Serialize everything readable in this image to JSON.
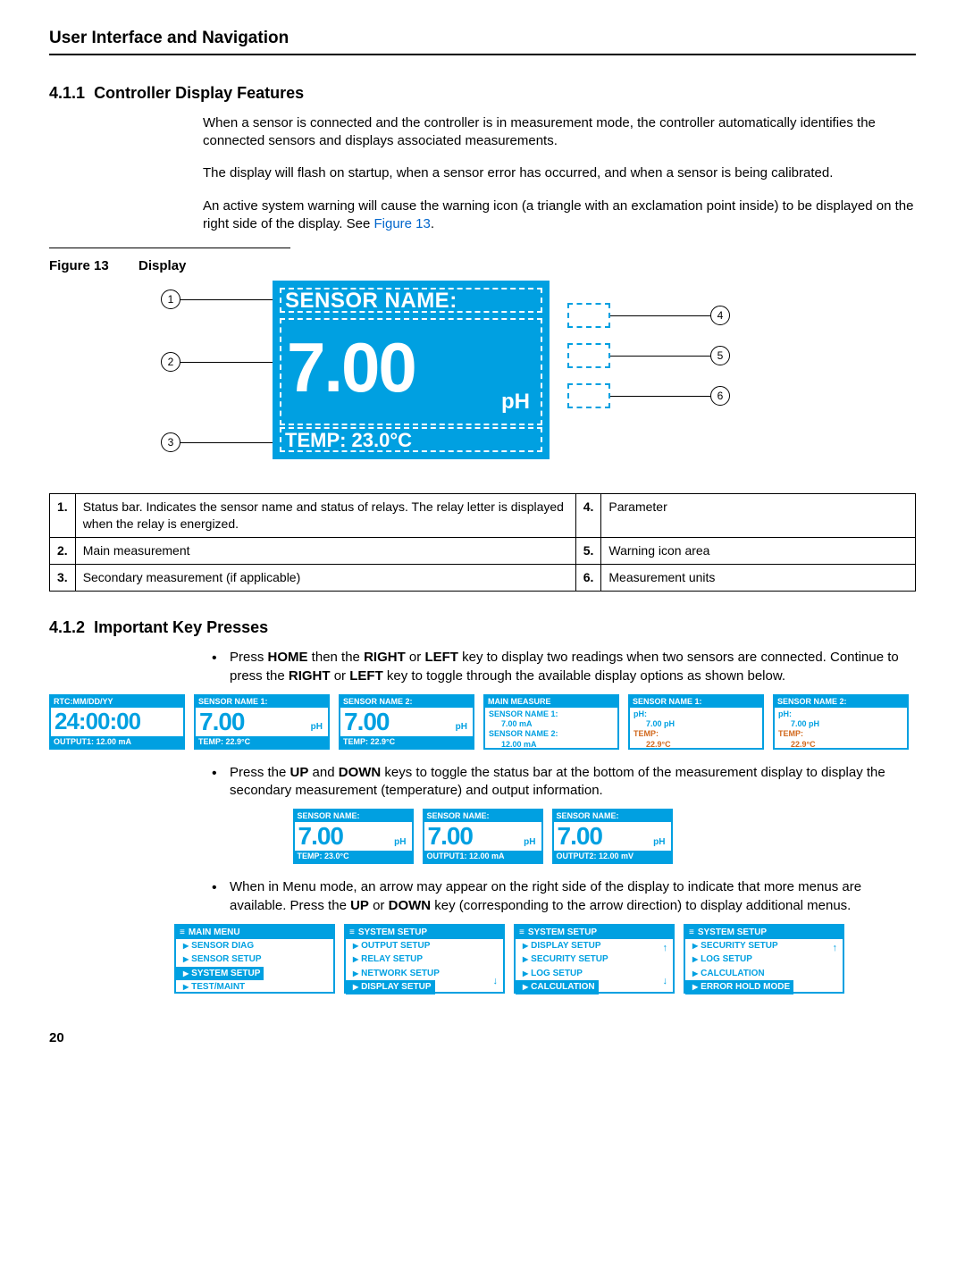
{
  "pageTitle": "User Interface and Navigation",
  "s411": {
    "num": "4.1.1",
    "title": "Controller Display Features",
    "p1": "When a sensor is connected and the controller is in measurement mode, the controller automatically identifies the connected sensors and displays associated measurements.",
    "p2": "The display will flash on startup, when a sensor error has occurred, and when a sensor is being calibrated.",
    "p3a": "An active system warning will cause the warning icon (a triangle with an exclamation point inside) to be displayed on the right side of the display. See ",
    "p3Link": "Figure 13",
    "p3b": "."
  },
  "fig13": {
    "label": "Figure 13",
    "caption": "Display",
    "sensorName": "SENSOR NAME:",
    "mainValue": "7.00",
    "unit": "pH",
    "secondary": "TEMP: 23.0°C",
    "callouts": {
      "c1": "1",
      "c2": "2",
      "c3": "3",
      "c4": "4",
      "c5": "5",
      "c6": "6"
    },
    "legend": [
      {
        "n": "1.",
        "t": "Status bar. Indicates the sensor name and status of relays. The relay letter is displayed when the relay is energized."
      },
      {
        "n": "2.",
        "t": "Main measurement"
      },
      {
        "n": "3.",
        "t": "Secondary measurement (if applicable)"
      },
      {
        "n": "4.",
        "t": "Parameter"
      },
      {
        "n": "5.",
        "t": "Warning icon area"
      },
      {
        "n": "6.",
        "t": "Measurement units"
      }
    ]
  },
  "s412": {
    "num": "4.1.2",
    "title": "Important Key Presses",
    "b1a": "Press ",
    "b1home": "HOME",
    "b1b": " then the ",
    "b1right": "RIGHT",
    "b1c": " or ",
    "b1left": "LEFT",
    "b1d": " key to display two readings when two sensors are connected. Continue to press the ",
    "b1e": " key to toggle through the available display options as shown below.",
    "b2a": "Press the ",
    "b2up": "UP",
    "b2b": " and ",
    "b2down": "DOWN",
    "b2c": " keys to toggle the status bar at the bottom of the measurement display to display the secondary measurement (temperature) and output information.",
    "b3a": "When in Menu mode, an arrow may appear on the right side of the display to indicate that more menus are available. Press the ",
    "b3b": " key (corresponding to the arrow direction) to display additional menus."
  },
  "miniRow1": [
    {
      "top": "RTC:MM/DD/YY",
      "big": "24:00:00",
      "bot": "OUTPUT1: 12.00 mA",
      "type": "time"
    },
    {
      "top": "SENSOR NAME 1:",
      "big": "7.00",
      "unit": "pH",
      "bot": "TEMP: 22.9°C"
    },
    {
      "top": "SENSOR NAME 2:",
      "big": "7.00",
      "unit": "pH",
      "bot": "TEMP: 22.9°C"
    },
    {
      "top": "MAIN MEASURE",
      "type": "lines",
      "l1": "SENSOR NAME 1:",
      "v1": "7.00 mA",
      "l2": "SENSOR NAME 2:",
      "v2": "12.00 mA"
    },
    {
      "top": "SENSOR NAME 1:",
      "type": "lines2",
      "l1": "pH:",
      "v1": "7.00 pH",
      "l2": "TEMP:",
      "v2": "22.9°C"
    },
    {
      "top": "SENSOR NAME 2:",
      "type": "lines2",
      "l1": "pH:",
      "v1": "7.00 pH",
      "l2": "TEMP:",
      "v2": "22.9°C"
    }
  ],
  "miniRow2": [
    {
      "top": "SENSOR NAME:",
      "big": "7.00",
      "unit": "pH",
      "bot": "TEMP: 23.0°C"
    },
    {
      "top": "SENSOR NAME:",
      "big": "7.00",
      "unit": "pH",
      "bot": "OUTPUT1: 12.00 mA"
    },
    {
      "top": "SENSOR NAME:",
      "big": "7.00",
      "unit": "pH",
      "bot": "OUTPUT2: 12.00 mV"
    }
  ],
  "menus": [
    {
      "head": "MAIN MENU",
      "items": [
        "SENSOR DIAG",
        "SENSOR SETUP",
        "SYSTEM SETUP",
        "TEST/MAINT"
      ],
      "sel": 2
    },
    {
      "head": "SYSTEM SETUP",
      "items": [
        "OUTPUT SETUP",
        "RELAY SETUP",
        "NETWORK SETUP",
        "DISPLAY SETUP"
      ],
      "sel": 3,
      "dn": true
    },
    {
      "head": "SYSTEM SETUP",
      "items": [
        "DISPLAY SETUP",
        "SECURITY SETUP",
        "LOG SETUP",
        "CALCULATION"
      ],
      "sel": 3,
      "up": true,
      "dn": true
    },
    {
      "head": "SYSTEM SETUP",
      "items": [
        "SECURITY SETUP",
        "LOG SETUP",
        "CALCULATION",
        "ERROR HOLD MODE"
      ],
      "sel": 3,
      "up": true
    }
  ],
  "pageNum": "20"
}
